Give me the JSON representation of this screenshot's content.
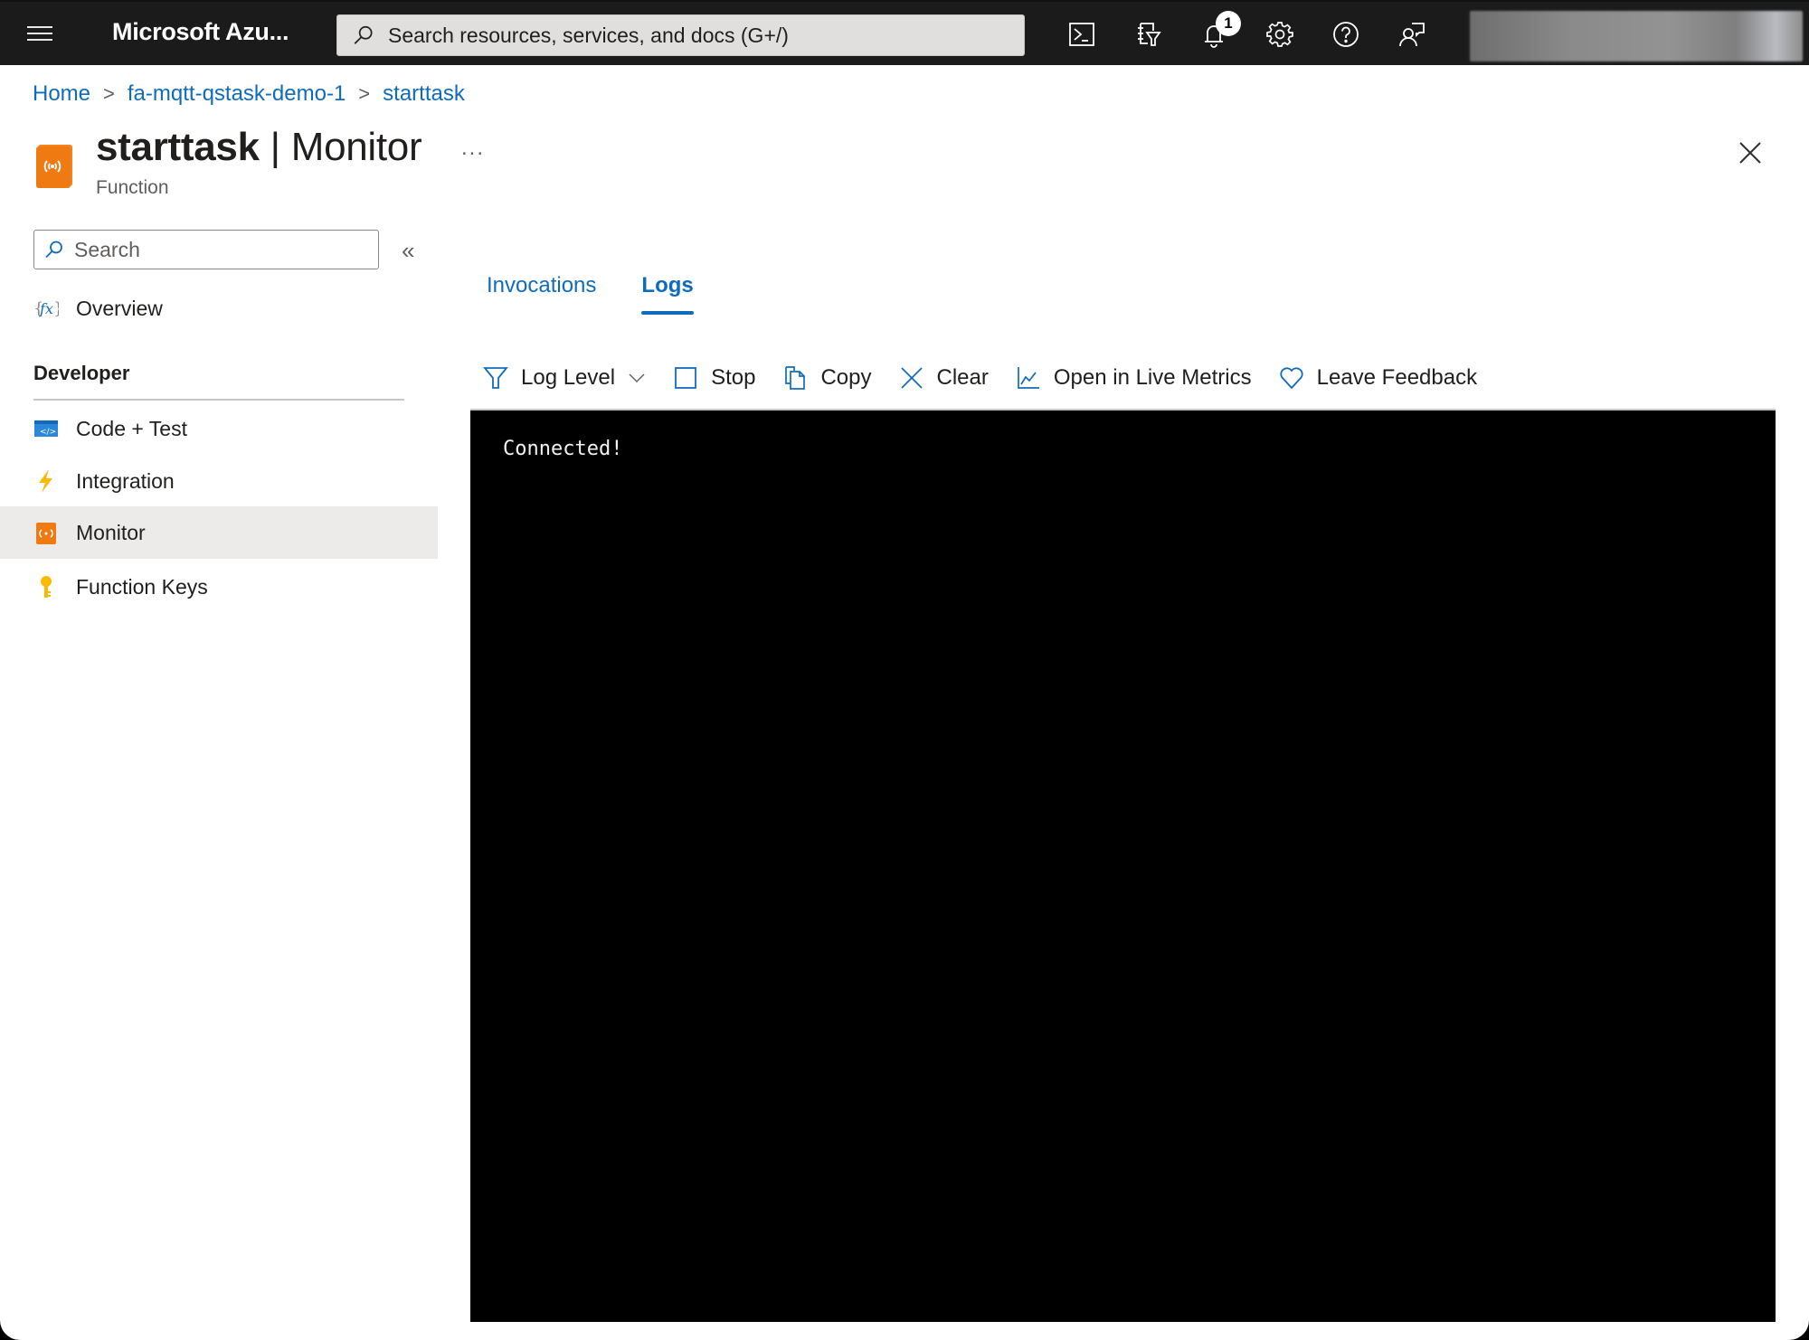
{
  "topbar": {
    "brand": "Microsoft Azu...",
    "search_placeholder": "Search resources, services, and docs (G+/)",
    "icons": [
      "cloud-shell-icon",
      "directory-filter-icon",
      "notifications-icon",
      "settings-icon",
      "help-icon",
      "feedback-icon"
    ],
    "notification_count": "1"
  },
  "breadcrumb": {
    "items": [
      "Home",
      "fa-mqtt-qstask-demo-1",
      "starttask"
    ],
    "separator": ">"
  },
  "header": {
    "title_bold": "starttask",
    "title_rest": " | Monitor",
    "subtitle": "Function",
    "more_label": "...",
    "close_label": "Close"
  },
  "sidebar": {
    "search_placeholder": "Search",
    "collapse_label": "«",
    "overview_label": "Overview",
    "section_developer": "Developer",
    "items": [
      {
        "label": "Code + Test",
        "icon": "code-icon"
      },
      {
        "label": "Integration",
        "icon": "lightning-icon"
      },
      {
        "label": "Monitor",
        "icon": "monitor-icon",
        "selected": true
      },
      {
        "label": "Function Keys",
        "icon": "key-icon"
      }
    ]
  },
  "tabs": [
    {
      "label": "Invocations",
      "active": false
    },
    {
      "label": "Logs",
      "active": true
    }
  ],
  "toolbar": {
    "log_level": "Log Level",
    "stop": "Stop",
    "copy": "Copy",
    "clear": "Clear",
    "live_metrics": "Open in Live Metrics",
    "feedback": "Leave Feedback"
  },
  "console": {
    "lines": [
      "Connected!"
    ]
  },
  "colors": {
    "accent": "#0f6cbd",
    "topbar": "#1b1b1b",
    "console_bg": "#000000",
    "function_orange": "#f7811e",
    "selected_row": "#edebe9"
  }
}
